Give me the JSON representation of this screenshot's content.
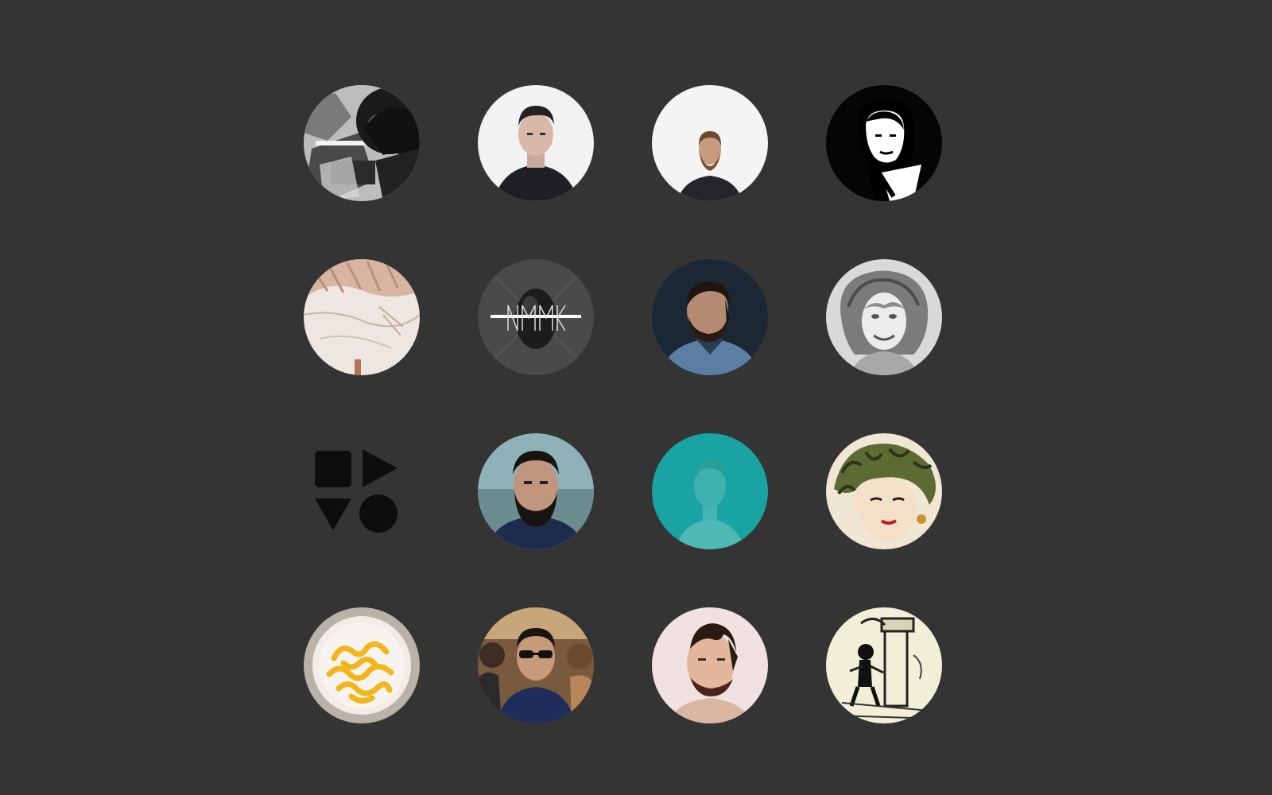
{
  "page": {
    "background_color": "#343434"
  },
  "avatars": [
    {
      "id": "avatar-1",
      "icon": "bw-photo-person-with-headphones"
    },
    {
      "id": "avatar-2",
      "icon": "portrait-man-black-shirt"
    },
    {
      "id": "avatar-3",
      "icon": "portrait-bearded-man-white-wall"
    },
    {
      "id": "avatar-4",
      "icon": "bw-illustration-woman"
    },
    {
      "id": "avatar-5",
      "icon": "abstract-sketch-pattern"
    },
    {
      "id": "avatar-6",
      "icon": "dark-logo-crossed-letters"
    },
    {
      "id": "avatar-7",
      "icon": "portrait-bearded-man-dark"
    },
    {
      "id": "avatar-8",
      "icon": "pencil-drawing-woman"
    },
    {
      "id": "avatar-9",
      "icon": "shapes-logo-square-triangle-circle"
    },
    {
      "id": "avatar-10",
      "icon": "portrait-bearded-man-blue"
    },
    {
      "id": "avatar-11",
      "icon": "teal-tinted-portrait"
    },
    {
      "id": "avatar-12",
      "icon": "comic-medusa-illustration"
    },
    {
      "id": "avatar-13",
      "icon": "plate-of-pasta"
    },
    {
      "id": "avatar-14",
      "icon": "man-with-sunglasses-crowd"
    },
    {
      "id": "avatar-15",
      "icon": "portrait-man-pink-background"
    },
    {
      "id": "avatar-16",
      "icon": "vintage-cartoon-sketch"
    }
  ]
}
